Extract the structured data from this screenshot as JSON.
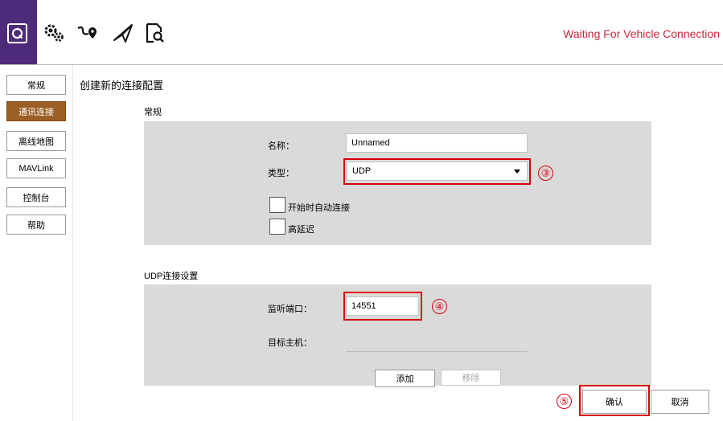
{
  "toolbar": {
    "icons": [
      "app-logo-icon",
      "gears-icon",
      "plan-route-icon",
      "fly-icon",
      "analyze-icon"
    ],
    "status": "Waiting For Vehicle Connection",
    "status_color": "#c9283e"
  },
  "sidebar": {
    "items": [
      {
        "label": "常规",
        "active": false
      },
      {
        "label": "通讯连接",
        "active": true
      },
      {
        "label": "离线地图",
        "active": false
      },
      {
        "label": "MAVLink",
        "active": false
      },
      {
        "label": "控制台",
        "active": false
      },
      {
        "label": "帮助",
        "active": false
      }
    ]
  },
  "main": {
    "title": "创建新的连接配置",
    "general": {
      "section_label": "常规",
      "name_label": "名称：",
      "name_value": "Unnamed",
      "type_label": "类型：",
      "type_value": "UDP",
      "auto_connect_label": "开始时自动连接",
      "high_latency_label": "高延迟"
    },
    "udp": {
      "section_label": "UDP连接设置",
      "port_label": "监听端口：",
      "port_value": "14551",
      "target_host_label": "目标主机：",
      "add_label": "添加",
      "remove_label": "移除"
    },
    "confirm_label": "确认",
    "cancel_label": "取消"
  },
  "annotations": {
    "three": "③",
    "four": "④",
    "five": "⑤",
    "color": "#d9000d"
  },
  "colors": {
    "accent_active": "#9b5f25",
    "logo_bg": "#4e2a7a",
    "panel_bg": "#dadada"
  }
}
